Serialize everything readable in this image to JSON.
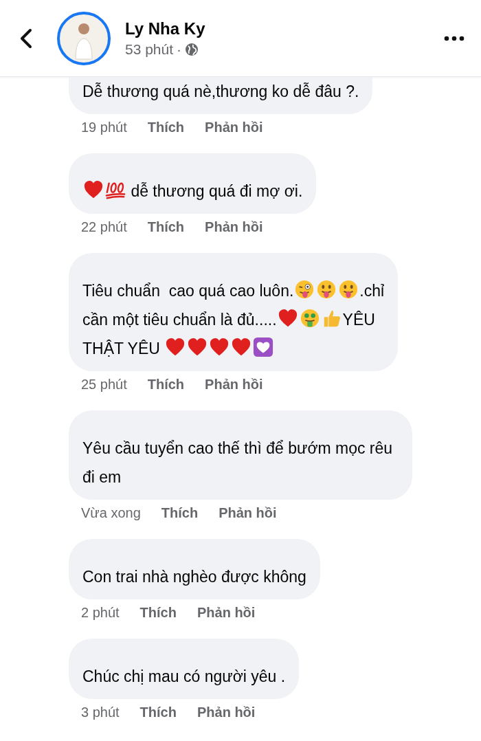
{
  "header": {
    "name": "Ly Nha Ky",
    "time": "53 phút",
    "separator": "·"
  },
  "comments": [
    {
      "clipped": true,
      "lines": [
        [
          {
            "kind": "text",
            "text": "Dễ thương quá nè,thương ko dễ đâu ?."
          }
        ]
      ],
      "time": "19 phút",
      "like": "Thích",
      "reply": "Phản hồi"
    },
    {
      "clipped": false,
      "lines": [
        [
          {
            "kind": "heart"
          },
          {
            "kind": "hundred"
          },
          {
            "kind": "text",
            "text": " dễ thương quá đi mợ ơi."
          }
        ]
      ],
      "time": "22 phút",
      "like": "Thích",
      "reply": "Phản hồi"
    },
    {
      "clipped": false,
      "lines": [
        [
          {
            "kind": "text",
            "text": "Tiêu chuẩn  cao quá cao luôn."
          },
          {
            "kind": "wink-tongue"
          },
          {
            "kind": "tongue"
          },
          {
            "kind": "tongue"
          },
          {
            "kind": "text",
            "text": ".chỉ"
          }
        ],
        [
          {
            "kind": "text",
            "text": "cần một tiêu chuẩn là đủ....."
          },
          {
            "kind": "heart"
          },
          {
            "kind": "money"
          },
          {
            "kind": "thumbs-up"
          },
          {
            "kind": "text",
            "text": "YÊU"
          }
        ],
        [
          {
            "kind": "text",
            "text": "THẬT YÊU "
          },
          {
            "kind": "heart"
          },
          {
            "kind": "heart"
          },
          {
            "kind": "heart"
          },
          {
            "kind": "heart"
          },
          {
            "kind": "white-heart"
          }
        ]
      ],
      "time": "25 phút",
      "like": "Thích",
      "reply": "Phản hồi"
    },
    {
      "clipped": false,
      "lines": [
        [
          {
            "kind": "text",
            "text": "Yêu cầu tuyển cao thế thì để bướm mọc rêu đi em"
          }
        ]
      ],
      "time": "Vừa xong",
      "like": "Thích",
      "reply": "Phản hồi"
    },
    {
      "clipped": false,
      "lines": [
        [
          {
            "kind": "text",
            "text": "Con trai nhà nghèo được không"
          }
        ]
      ],
      "time": "2 phút",
      "like": "Thích",
      "reply": "Phản hồi"
    },
    {
      "clipped": false,
      "lines": [
        [
          {
            "kind": "text",
            "text": "Chúc chị mau có người yêu ."
          }
        ]
      ],
      "time": "3 phút",
      "like": "Thích",
      "reply": "Phản hồi"
    }
  ]
}
